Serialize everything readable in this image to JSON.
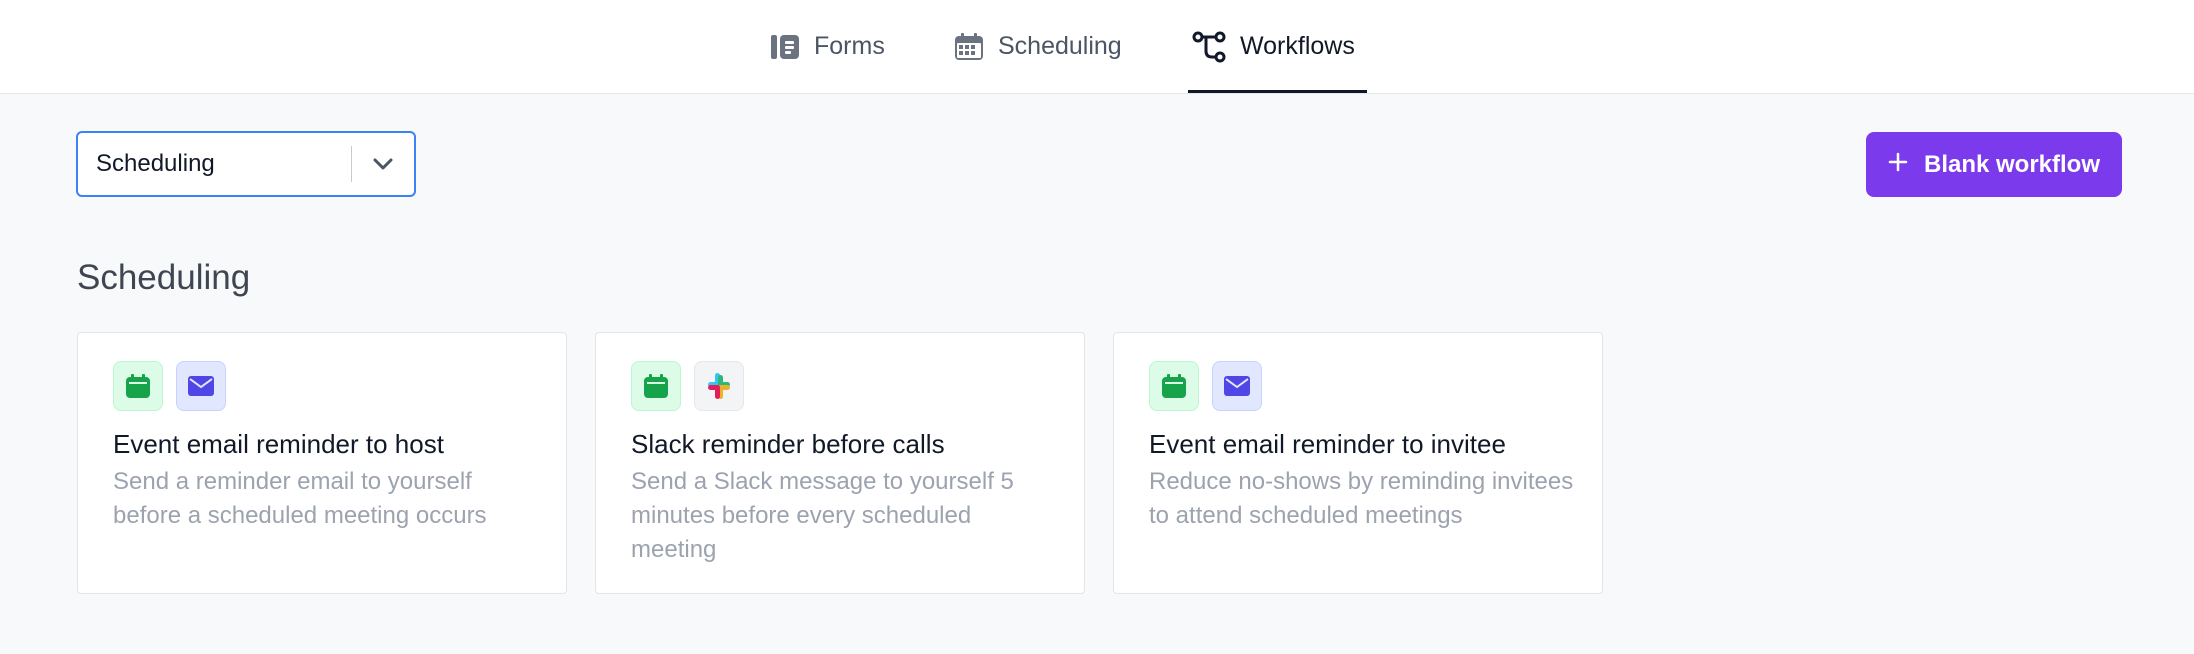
{
  "tabs": [
    {
      "label": "Forms",
      "icon": "forms-icon"
    },
    {
      "label": "Scheduling",
      "icon": "calendar-grid-icon"
    },
    {
      "label": "Workflows",
      "icon": "workflow-icon"
    }
  ],
  "active_tab": "Workflows",
  "filter": {
    "value": "Scheduling"
  },
  "blank_button": {
    "label": "Blank workflow"
  },
  "section_title": "Scheduling",
  "cards": [
    {
      "title": "Event email reminder to host",
      "description": "Send a reminder email to yourself before a scheduled meeting occurs",
      "icons": [
        "calendar-icon",
        "mail-icon"
      ]
    },
    {
      "title": "Slack reminder before calls",
      "description": "Send a Slack message to yourself 5 minutes before every scheduled meeting",
      "icons": [
        "calendar-icon",
        "slack-icon"
      ]
    },
    {
      "title": "Event email reminder to invitee",
      "description": "Reduce no-shows by reminding invitees to attend scheduled meetings",
      "icons": [
        "calendar-icon",
        "mail-icon"
      ]
    }
  ],
  "colors": {
    "accent": "#7c3aed",
    "focus_border": "#3b82f6",
    "calendar_icon": "#16a34a",
    "mail_icon": "#4f46e5"
  }
}
